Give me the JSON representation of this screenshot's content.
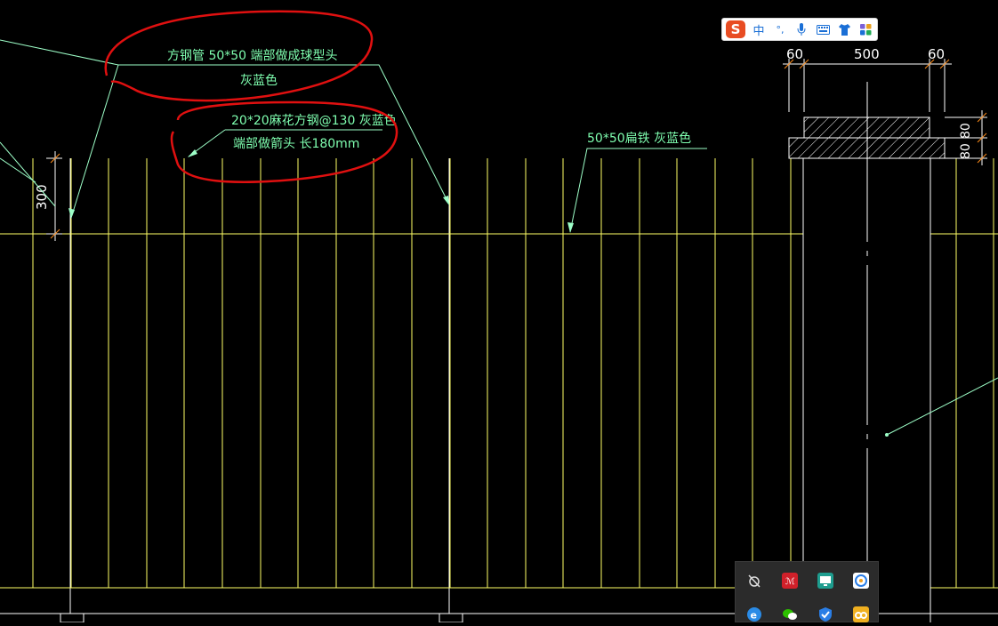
{
  "annotations": {
    "pipe_line1": "方钢管 50*50  端部做成球型头",
    "pipe_line2": "灰蓝色",
    "bar_line1": "20*20麻花方钢@130  灰蓝色",
    "bar_line2": "端部做箭头  长180mm",
    "flat_steel": "50*50扁铁  灰蓝色"
  },
  "dimensions": {
    "left_offset": "60",
    "span": "500",
    "right_offset": "60",
    "height_300": "300",
    "cap_1": "80",
    "cap_2": "80"
  },
  "ime_toolbar": {
    "logo": "S",
    "mode": "中",
    "punct": "°,",
    "items": [
      "mic-icon",
      "keyboard-icon",
      "skin-icon",
      "apps-icon"
    ]
  },
  "tray": {
    "icons": [
      "network-monitor-icon",
      "red-app-icon",
      "remote-desktop-icon",
      "cloud-app-icon",
      "browser-icon",
      "wechat-icon",
      "security-shield-icon",
      "baidu-netdisk-icon"
    ]
  },
  "colors": {
    "background": "#000000",
    "post_lines": "#ffff66",
    "annotation_text": "#7fffb0",
    "leader_lines": "#9dffc8",
    "markup_red": "#e01010",
    "dimension_orange": "#ff8c1a",
    "structure_white": "#ffffff"
  }
}
